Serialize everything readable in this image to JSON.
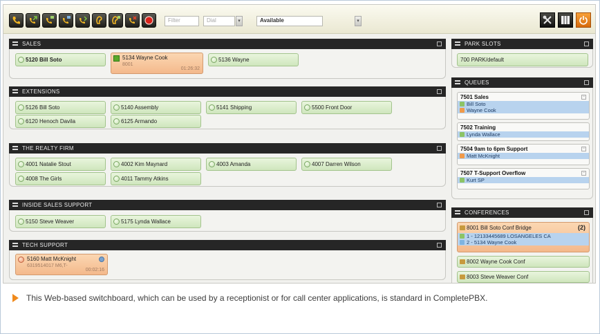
{
  "toolbar": {
    "buttons": [
      "call-icon",
      "call-transfer-icon",
      "call-park-icon",
      "call-conference-icon",
      "call-pickup-icon",
      "voicemail-icon",
      "intercom-icon",
      "call-hold-icon",
      "record-icon"
    ],
    "filter_placeholder": "Filter",
    "dial_placeholder": "Dial",
    "status": "Available",
    "right_buttons": [
      "settings-icon",
      "layout-icon",
      "power-icon"
    ]
  },
  "sections": {
    "sales": {
      "title": "SALES",
      "exts": [
        "5120 Bill Soto",
        "5136 Wayne"
      ],
      "active": {
        "name": "5134 Wayne Cook",
        "sub": "8001",
        "timer": "01:26:32"
      }
    },
    "extensions": {
      "title": "EXTENSIONS",
      "exts": [
        "5126 Bill Soto",
        "5140 Assembly",
        "5141 Shipping",
        "5500 Front Door",
        "6120 Henoch Davila",
        "6125 Armando"
      ]
    },
    "realty": {
      "title": "THE REALTY FIRM",
      "exts": [
        "4001 Natalie Stout",
        "4002 Kim Maynard",
        "4003 Amanda",
        "4007 Darren Wilson",
        "4008 The Girls",
        "4011 Tammy Atkins"
      ]
    },
    "inside": {
      "title": "INSIDE SALES SUPPORT",
      "exts": [
        "5150 Steve Weaver",
        "5175 Lynda Wallace"
      ]
    },
    "tech": {
      "title": "TECH SUPPORT",
      "active": {
        "name": "5160 Matt McKnight",
        "sub": "6319514017 M6,T-",
        "timer": "00:02:16"
      }
    }
  },
  "park": {
    "title": "PARK SLOTS",
    "slot": "700 PARK/default"
  },
  "queues": {
    "title": "QUEUES",
    "items": [
      {
        "name": "7501 Sales",
        "members": [
          "Bill Soto",
          "Wayne Cook"
        ]
      },
      {
        "name": "7502 Training",
        "members": [
          "Lynda Wallace"
        ]
      },
      {
        "name": "7504 9am to 6pm Support",
        "members": [
          "Matt McKnight"
        ]
      },
      {
        "name": "7507 T-Support Overflow",
        "members": [
          "Kurt SP"
        ]
      }
    ]
  },
  "conferences": {
    "title": "CONFERENCES",
    "active": {
      "name": "8001 Bill Soto Conf Bridge",
      "count": "(2)",
      "participants": [
        "1 - 12133445689 LOSANGELES CA",
        "2 - 5134 Wayne Cook"
      ]
    },
    "items": [
      "8002 Wayne Cook Conf",
      "8003 Steve Weaver Conf"
    ]
  },
  "caption": "This Web-based switchboard, which can be used by a receptionist or for call center applications, is standard in CompletePBX.",
  "colors": {
    "accent": "#f08a1c",
    "header": "#262626",
    "idle": "#cfe6bd",
    "busy": "#f4b98c",
    "queue_member": "#b8d3ee"
  }
}
